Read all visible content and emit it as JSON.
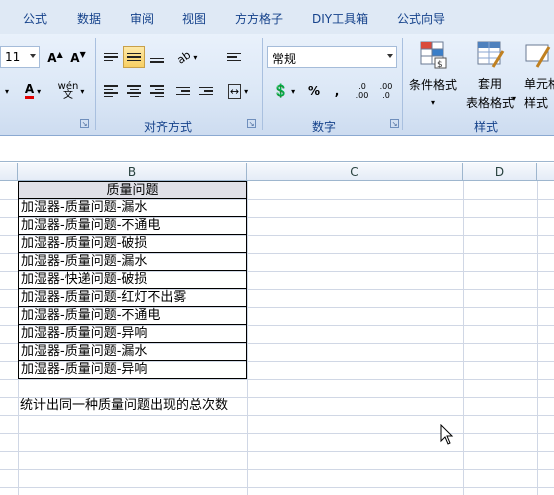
{
  "tabs": [
    "公式",
    "数据",
    "审阅",
    "视图",
    "方方格子",
    "DIY工具箱",
    "公式向导"
  ],
  "ribbon": {
    "font_size_value": "11",
    "number_format_value": "常规",
    "percent_label": "%",
    "comma_label": ",",
    "decimal_increase_label": ".0 .00",
    "decimal_decrease_label": ".00 .0",
    "groups": {
      "alignment_label": "对齐方式",
      "number_label": "数字",
      "styles_label": "样式"
    },
    "styles_buttons": {
      "conditional_format_label": "条件格式",
      "table_format_label_1": "套用",
      "table_format_label_2": "表格格式",
      "cell_style_label_1": "单元格",
      "cell_style_label_2": "样式"
    }
  },
  "sheet": {
    "columns": [
      "B",
      "C",
      "D"
    ],
    "header_cell": "质量问题",
    "rows": [
      "加湿器-质量问题-漏水",
      "加湿器-质量问题-不通电",
      "加湿器-质量问题-破损",
      "加湿器-质量问题-漏水",
      "加湿器-快递问题-破损",
      "加湿器-质量问题-红灯不出雾",
      "加湿器-质量问题-不通电",
      "加湿器-质量问题-异响",
      "加湿器-质量问题-漏水",
      "加湿器-质量问题-异响"
    ],
    "note": "统计出同一种质量问题出现的总次数"
  },
  "colors": {
    "accent": "#15428b",
    "highlight": "#f8cf62",
    "grid": "#d0d7e5",
    "header_fill": "#e0e0e8"
  }
}
